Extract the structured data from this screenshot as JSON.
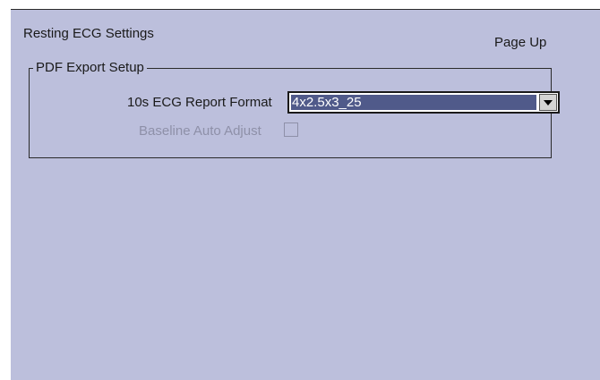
{
  "header": {
    "title": "Resting ECG Settings",
    "page_up_label": "Page Up"
  },
  "pdf_export": {
    "legend": "PDF Export Setup",
    "report_format_label": "10s ECG Report Format",
    "report_format_value": "4x2.5x3_25",
    "baseline_label": "Baseline Auto Adjust",
    "baseline_checked": false,
    "baseline_enabled": false
  },
  "colors": {
    "panel_bg": "#bcbfdc",
    "selection_bg": "#505a8a",
    "disabled_text": "#8e90a8"
  }
}
